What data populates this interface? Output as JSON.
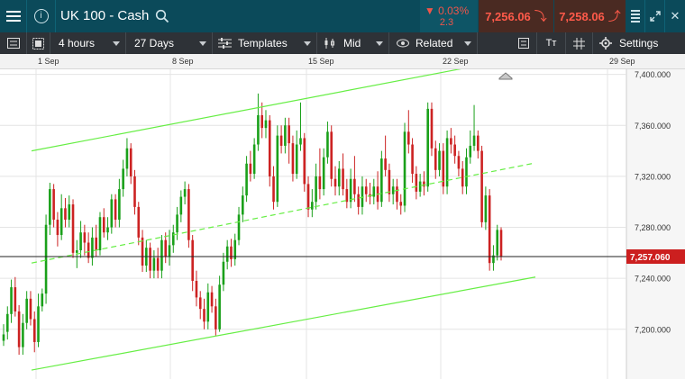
{
  "header": {
    "title": "UK 100 - Cash",
    "change_pct": "0.03%",
    "change_abs": "2.3",
    "sell_price": "7,256.06",
    "buy_price": "7,258.06",
    "info_glyph": "i",
    "close_glyph": "✕"
  },
  "toolbar": {
    "interval": "4 hours",
    "range": "27 Days",
    "templates": "Templates",
    "price_type": "Mid",
    "related": "Related",
    "settings": "Settings",
    "text_glyph": "Tт"
  },
  "chart_data": {
    "type": "candlestick",
    "current_price_label": "7,257.060",
    "current_price": 7257.06,
    "x_tick_labels": [
      "1 Sep",
      "8 Sep",
      "15 Sep",
      "22 Sep",
      "29 Sep"
    ],
    "y_tick_labels": [
      "7,400.000",
      "7,360.000",
      "7,320.000",
      "7,280.000",
      "7,240.000",
      "7,200.000"
    ],
    "y_ticks": [
      7400,
      7360,
      7320,
      7280,
      7240,
      7200
    ],
    "ylim": [
      7161,
      7404
    ],
    "grid": true,
    "colors": {
      "up": "#1aa01a",
      "down": "#cc2222",
      "channel": "#66ee44",
      "current_line": "#222222"
    },
    "trend_channel": {
      "upper": {
        "start": 7340,
        "end": 7411
      },
      "middle": {
        "start": 7252,
        "end": 7330
      },
      "lower": {
        "start": 7168,
        "end": 7241
      }
    },
    "candles": [
      [
        7191,
        7196,
        7187,
        7204
      ],
      [
        7198,
        7212,
        7192,
        7218
      ],
      [
        7212,
        7233,
        7205,
        7239
      ],
      [
        7233,
        7214,
        7210,
        7241
      ],
      [
        7214,
        7186,
        7180,
        7219
      ],
      [
        7186,
        7205,
        7180,
        7212
      ],
      [
        7205,
        7224,
        7200,
        7230
      ],
      [
        7224,
        7208,
        7203,
        7230
      ],
      [
        7208,
        7190,
        7182,
        7214
      ],
      [
        7190,
        7218,
        7186,
        7228
      ],
      [
        7218,
        7228,
        7214,
        7232
      ],
      [
        7228,
        7282,
        7220,
        7290
      ],
      [
        7282,
        7310,
        7274,
        7315
      ],
      [
        7310,
        7286,
        7280,
        7314
      ],
      [
        7286,
        7274,
        7265,
        7292
      ],
      [
        7274,
        7295,
        7270,
        7306
      ],
      [
        7295,
        7286,
        7280,
        7303
      ],
      [
        7286,
        7298,
        7280,
        7305
      ],
      [
        7298,
        7260,
        7256,
        7302
      ],
      [
        7260,
        7262,
        7248,
        7270
      ],
      [
        7262,
        7276,
        7256,
        7285
      ],
      [
        7276,
        7268,
        7258,
        7282
      ],
      [
        7268,
        7256,
        7252,
        7276
      ],
      [
        7256,
        7272,
        7250,
        7280
      ],
      [
        7272,
        7262,
        7257,
        7282
      ],
      [
        7262,
        7288,
        7258,
        7292
      ],
      [
        7288,
        7276,
        7272,
        7295
      ],
      [
        7276,
        7280,
        7270,
        7288
      ],
      [
        7280,
        7302,
        7275,
        7306
      ],
      [
        7302,
        7286,
        7280,
        7306
      ],
      [
        7286,
        7310,
        7280,
        7318
      ],
      [
        7310,
        7326,
        7304,
        7333
      ],
      [
        7326,
        7342,
        7320,
        7350
      ],
      [
        7342,
        7320,
        7314,
        7346
      ],
      [
        7320,
        7296,
        7290,
        7325
      ],
      [
        7296,
        7272,
        7266,
        7300
      ],
      [
        7272,
        7250,
        7245,
        7278
      ],
      [
        7250,
        7264,
        7245,
        7270
      ],
      [
        7264,
        7246,
        7240,
        7268
      ],
      [
        7246,
        7256,
        7240,
        7262
      ],
      [
        7256,
        7246,
        7240,
        7264
      ],
      [
        7246,
        7270,
        7240,
        7274
      ],
      [
        7270,
        7257,
        7252,
        7276
      ],
      [
        7257,
        7266,
        7250,
        7278
      ],
      [
        7266,
        7276,
        7260,
        7282
      ],
      [
        7276,
        7290,
        7270,
        7296
      ],
      [
        7290,
        7304,
        7284,
        7309
      ],
      [
        7304,
        7310,
        7298,
        7316
      ],
      [
        7310,
        7270,
        7264,
        7314
      ],
      [
        7270,
        7238,
        7230,
        7274
      ],
      [
        7238,
        7225,
        7218,
        7246
      ],
      [
        7225,
        7216,
        7208,
        7230
      ],
      [
        7216,
        7206,
        7200,
        7224
      ],
      [
        7206,
        7229,
        7200,
        7236
      ],
      [
        7229,
        7218,
        7213,
        7234
      ],
      [
        7218,
        7200,
        7195,
        7224
      ],
      [
        7200,
        7235,
        7198,
        7242
      ],
      [
        7235,
        7253,
        7230,
        7260
      ],
      [
        7253,
        7265,
        7247,
        7270
      ],
      [
        7265,
        7255,
        7249,
        7271
      ],
      [
        7255,
        7270,
        7250,
        7275
      ],
      [
        7270,
        7290,
        7266,
        7296
      ],
      [
        7290,
        7305,
        7284,
        7312
      ],
      [
        7305,
        7330,
        7300,
        7336
      ],
      [
        7330,
        7322,
        7316,
        7340
      ],
      [
        7322,
        7345,
        7318,
        7350
      ],
      [
        7345,
        7368,
        7340,
        7385
      ],
      [
        7368,
        7358,
        7350,
        7378
      ],
      [
        7358,
        7364,
        7350,
        7372
      ],
      [
        7364,
        7320,
        7312,
        7368
      ],
      [
        7320,
        7300,
        7294,
        7328
      ],
      [
        7300,
        7352,
        7296,
        7360
      ],
      [
        7352,
        7344,
        7338,
        7360
      ],
      [
        7344,
        7360,
        7338,
        7366
      ],
      [
        7360,
        7346,
        7330,
        7366
      ],
      [
        7346,
        7322,
        7316,
        7352
      ],
      [
        7322,
        7345,
        7318,
        7356
      ],
      [
        7345,
        7350,
        7340,
        7378
      ],
      [
        7350,
        7314,
        7308,
        7354
      ],
      [
        7314,
        7294,
        7288,
        7320
      ],
      [
        7294,
        7300,
        7288,
        7310
      ],
      [
        7300,
        7320,
        7294,
        7330
      ],
      [
        7320,
        7310,
        7302,
        7342
      ],
      [
        7310,
        7335,
        7305,
        7342
      ],
      [
        7335,
        7355,
        7330,
        7363
      ],
      [
        7355,
        7318,
        7312,
        7360
      ],
      [
        7318,
        7312,
        7305,
        7328
      ],
      [
        7312,
        7326,
        7305,
        7332
      ],
      [
        7326,
        7310,
        7305,
        7338
      ],
      [
        7310,
        7300,
        7295,
        7318
      ],
      [
        7300,
        7318,
        7295,
        7326
      ],
      [
        7318,
        7306,
        7300,
        7336
      ],
      [
        7306,
        7296,
        7290,
        7312
      ],
      [
        7296,
        7312,
        7290,
        7320
      ],
      [
        7312,
        7306,
        7300,
        7318
      ],
      [
        7306,
        7304,
        7298,
        7315
      ],
      [
        7304,
        7312,
        7298,
        7318
      ],
      [
        7312,
        7300,
        7294,
        7324
      ],
      [
        7300,
        7334,
        7296,
        7340
      ],
      [
        7334,
        7325,
        7320,
        7352
      ],
      [
        7325,
        7306,
        7300,
        7330
      ],
      [
        7306,
        7312,
        7298,
        7318
      ],
      [
        7312,
        7300,
        7294,
        7318
      ],
      [
        7300,
        7297,
        7290,
        7306
      ],
      [
        7297,
        7355,
        7292,
        7362
      ],
      [
        7355,
        7345,
        7338,
        7372
      ],
      [
        7345,
        7322,
        7315,
        7350
      ],
      [
        7322,
        7308,
        7302,
        7328
      ],
      [
        7308,
        7316,
        7304,
        7322
      ],
      [
        7316,
        7312,
        7305,
        7324
      ],
      [
        7312,
        7373,
        7308,
        7378
      ],
      [
        7373,
        7342,
        7336,
        7378
      ],
      [
        7342,
        7325,
        7318,
        7348
      ],
      [
        7325,
        7340,
        7320,
        7346
      ],
      [
        7340,
        7312,
        7306,
        7346
      ],
      [
        7312,
        7350,
        7306,
        7356
      ],
      [
        7350,
        7345,
        7338,
        7358
      ],
      [
        7345,
        7336,
        7330,
        7352
      ],
      [
        7336,
        7326,
        7320,
        7340
      ],
      [
        7326,
        7312,
        7306,
        7332
      ],
      [
        7312,
        7335,
        7306,
        7342
      ],
      [
        7335,
        7344,
        7330,
        7356
      ],
      [
        7344,
        7352,
        7340,
        7376
      ],
      [
        7352,
        7340,
        7334,
        7356
      ],
      [
        7340,
        7284,
        7280,
        7344
      ],
      [
        7284,
        7305,
        7278,
        7312
      ],
      [
        7305,
        7252,
        7246,
        7310
      ],
      [
        7252,
        7258,
        7246,
        7266
      ],
      [
        7258,
        7278,
        7254,
        7282
      ],
      [
        7278,
        7257,
        7254,
        7280
      ]
    ]
  }
}
